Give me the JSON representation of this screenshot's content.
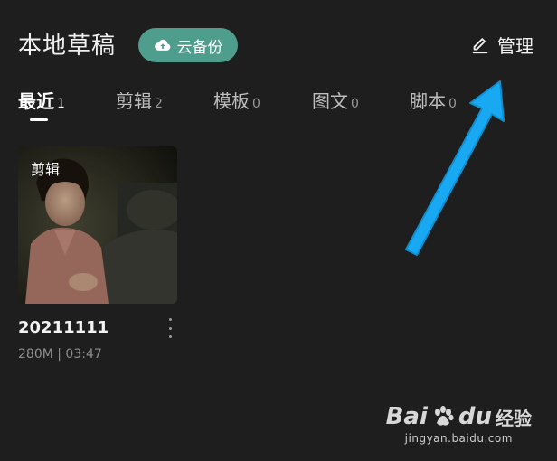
{
  "header": {
    "title": "本地草稿",
    "cloud_backup_label": "云备份",
    "manage_label": "管理"
  },
  "tabs": [
    {
      "label": "最近",
      "count": "1",
      "active": true
    },
    {
      "label": "剪辑",
      "count": "2",
      "active": false
    },
    {
      "label": "模板",
      "count": "0",
      "active": false
    },
    {
      "label": "图文",
      "count": "0",
      "active": false
    },
    {
      "label": "脚本",
      "count": "0",
      "active": false
    }
  ],
  "drafts": [
    {
      "tag": "剪辑",
      "name": "20211111",
      "meta": "280M | 03:47"
    }
  ],
  "annotation": {
    "color": "#1aa8f0"
  },
  "watermark": {
    "brand_left": "Bai",
    "brand_right": "du",
    "suffix": "经验",
    "url": "jingyan.baidu.com"
  },
  "colors": {
    "background": "#1e1e1e",
    "cloud_button": "#4f9d8d",
    "text": "#f0f0f0",
    "muted": "#8e8e8e"
  }
}
